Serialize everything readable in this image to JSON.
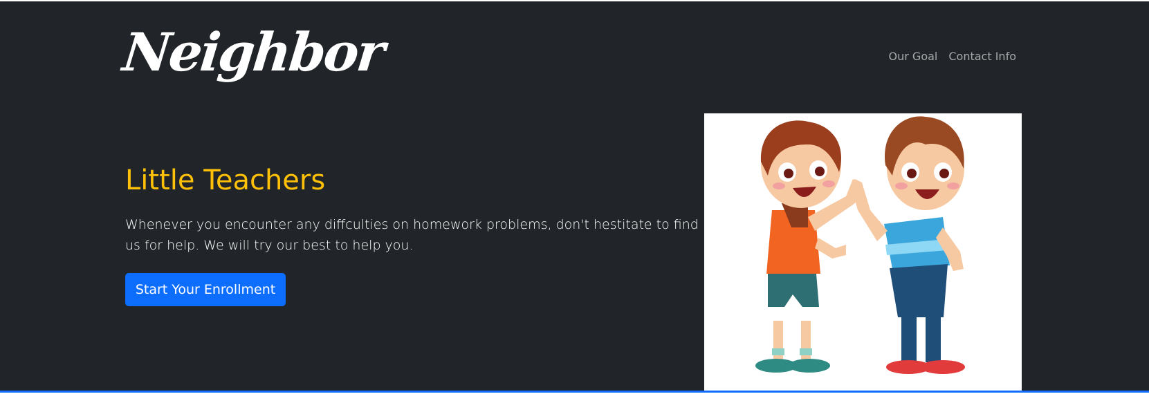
{
  "brand": {
    "logo_text": "Neighbor"
  },
  "nav": {
    "items": [
      {
        "label": "Our Goal"
      },
      {
        "label": "Contact Info"
      }
    ]
  },
  "hero": {
    "title": "Little Teachers",
    "text": "Whenever you encounter any diffculties on homework problems, don't hestitate to find us for help. We will try our best to help you.",
    "cta_label": "Start Your Enrollment",
    "image_alt": "two cartoon kids giving a high five"
  },
  "colors": {
    "background": "#212529",
    "accent_title": "#ffc107",
    "button": "#0d6efd",
    "nav_text": "rgba(255,255,255,0.6)"
  }
}
